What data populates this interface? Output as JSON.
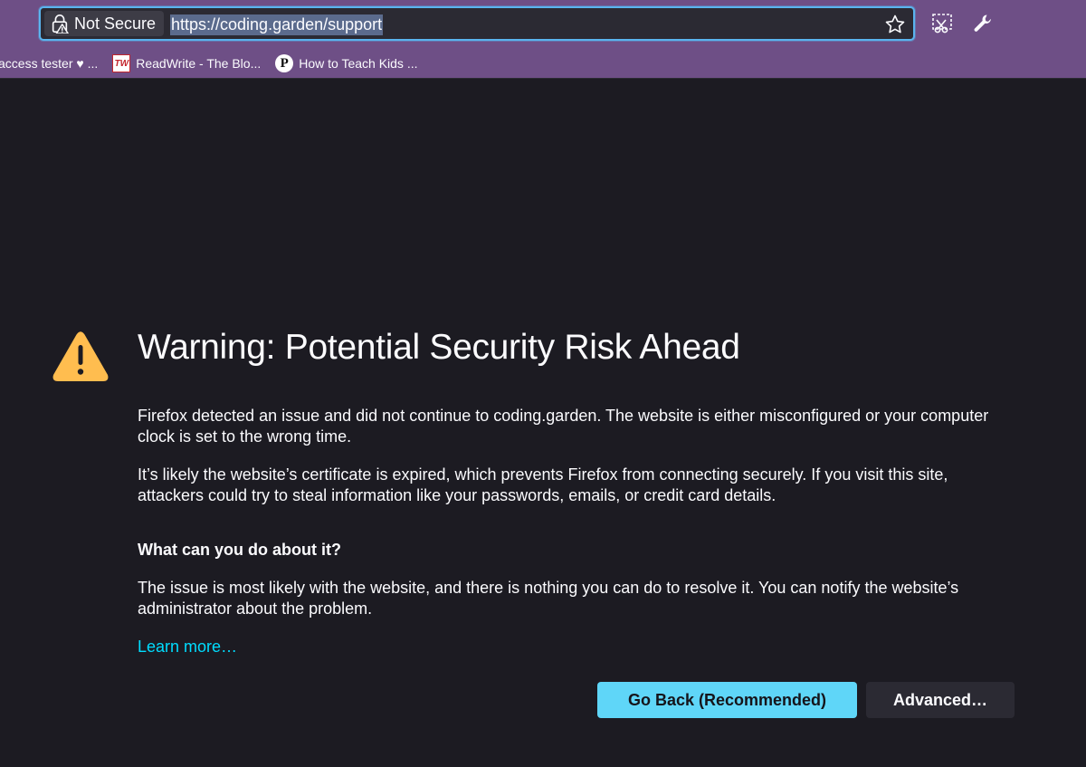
{
  "urlbar": {
    "identity_label": "Not Secure",
    "url": "https://coding.garden/support"
  },
  "bookmarks": [
    {
      "label": "access tester ♥ ..."
    },
    {
      "label": "ReadWrite - The Blo...",
      "favicon_text": "TW"
    },
    {
      "label": "How to Teach Kids ...",
      "favicon_text": "P"
    }
  ],
  "error_page": {
    "title": "Warning: Potential Security Risk Ahead",
    "para1": "Firefox detected an issue and did not continue to coding.garden. The website is either misconfigured or your computer clock is set to the wrong time.",
    "para2": "It’s likely the website’s certificate is expired, which prevents Firefox from connecting securely. If you visit this site, attackers could try to steal information like your passwords, emails, or credit card details.",
    "heading": "What can you do about it?",
    "para3": "The issue is most likely with the website, and there is nothing you can do to resolve it. You can notify the website’s administrator about the problem.",
    "learn_more": "Learn more…",
    "go_back_label": "Go Back (Recommended)",
    "advanced_label": "Advanced…"
  },
  "icons": [
    "lock-warning-icon",
    "star-icon",
    "screenshot-icon",
    "wrench-icon",
    "warning-icon"
  ],
  "colors": {
    "chrome_bg": "#6e4f86",
    "page_bg": "#1c1b22",
    "accent": "#00ddff",
    "warning": "#ffbd4f"
  }
}
